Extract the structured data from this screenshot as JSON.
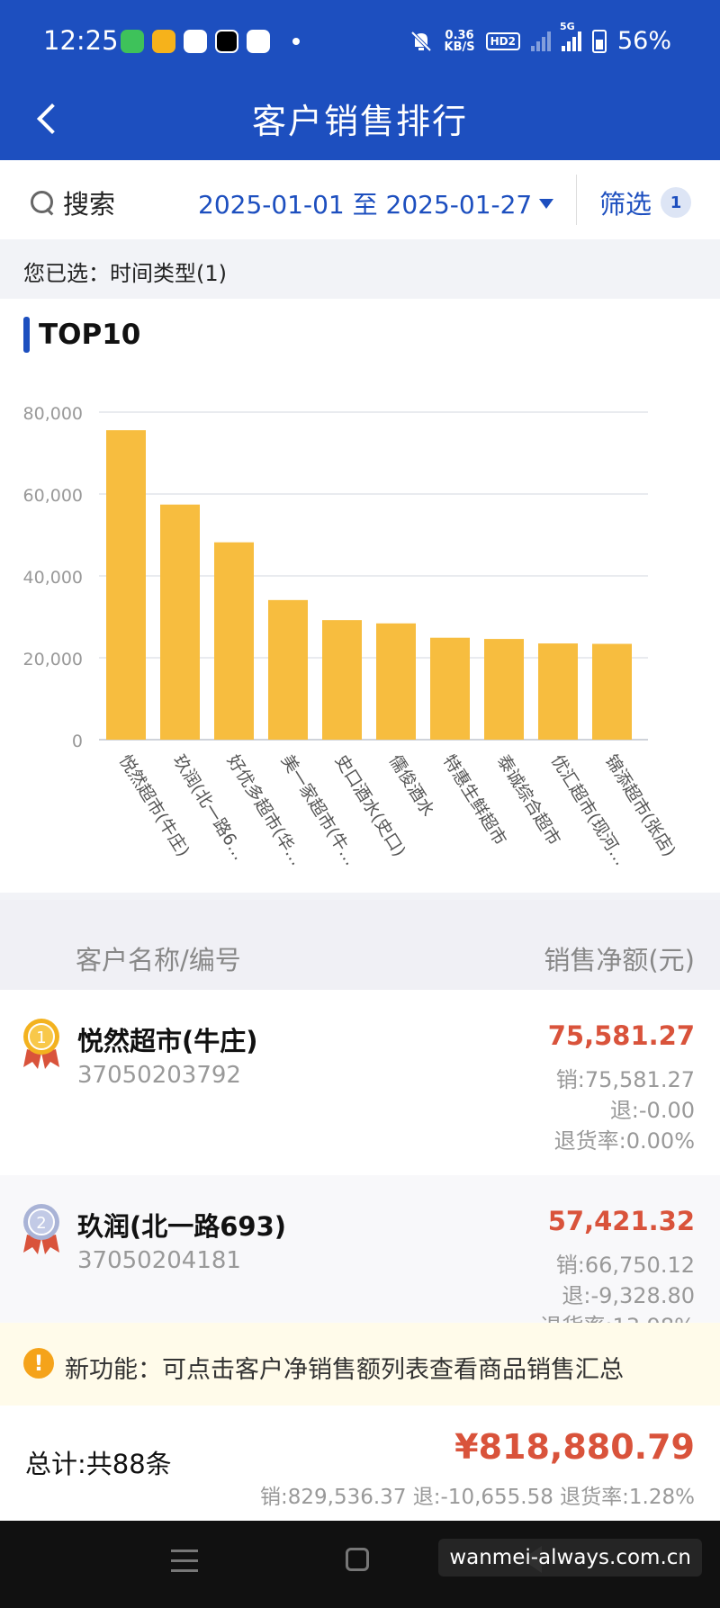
{
  "status_bar": {
    "time": "12:25",
    "net_speed": "0.36",
    "net_unit": "KB/S",
    "hd_label": "HD2",
    "network_type": "5G",
    "battery": "56%"
  },
  "header": {
    "title": "客户销售排行"
  },
  "filter_bar": {
    "search_label": "搜索",
    "date_range": "2025-01-01 至 2025-01-27",
    "filter_label": "筛选",
    "filter_count": "1"
  },
  "selected_filters": "您已选：时间类型(1)",
  "chart_data": {
    "type": "bar",
    "title": "TOP10",
    "categories": [
      "悦然超市(牛庄)",
      "玖润(北一路6…",
      "好优多超市(华…",
      "美一家超市(牛…",
      "史口酒水(史口)",
      "儒俊酒水",
      "特惠生鲜超市",
      "泰诚综合超市",
      "优汇超市(现河…",
      "锦添超市(张店)"
    ],
    "values": [
      75581.27,
      57421.32,
      48200,
      34100,
      29200,
      28400,
      24900,
      24600,
      23500,
      23400
    ],
    "ylim": [
      0,
      80000
    ],
    "yticks": [
      "0",
      "20,000",
      "40,000",
      "60,000",
      "80,000"
    ],
    "grid": true,
    "bar_color": "#f7bd3f"
  },
  "list": {
    "header_name": "客户名称/编号",
    "header_amount": "销售净额(元)",
    "rows": [
      {
        "rank": "1",
        "name": "悦然超市(牛庄)",
        "code": "37050203792",
        "net": "75,581.27",
        "sales": "销:75,581.27",
        "returns": "退:-0.00",
        "return_rate": "退货率:0.00%"
      },
      {
        "rank": "2",
        "name": "玖润(北一路693)",
        "code": "37050204181",
        "net": "57,421.32",
        "sales": "销:66,750.12",
        "returns": "退:-9,328.80",
        "return_rate": "退货率:13.98%"
      }
    ]
  },
  "notice": {
    "icon": "!",
    "text": "新功能：可点击客户净销售额列表查看商品销售汇总"
  },
  "total": {
    "label": "总计:共88条",
    "amount": "¥818,880.79",
    "summary": "销:829,536.37 退:-10,655.58 退货率:1.28%"
  },
  "watermark": "wanmei-always.com.cn",
  "colors": {
    "brand": "#1d4fbf",
    "accent_red": "#d9533b",
    "bar": "#f7bd3f"
  }
}
